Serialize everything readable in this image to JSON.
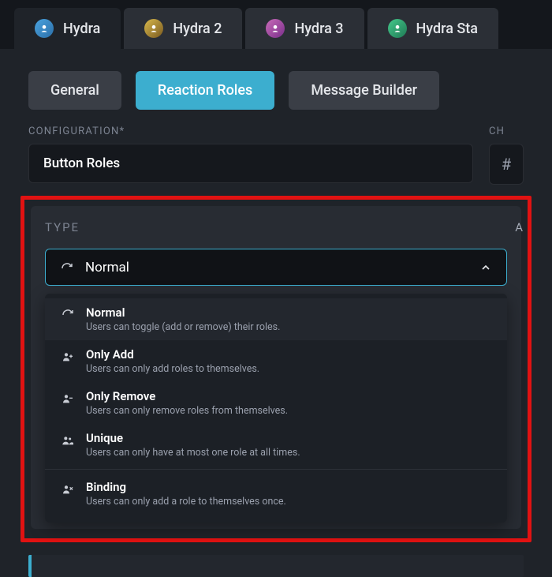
{
  "tabs": [
    {
      "label": "Hydra",
      "iconColor": "blue",
      "active": true
    },
    {
      "label": "Hydra 2",
      "iconColor": "yellow",
      "active": false
    },
    {
      "label": "Hydra 3",
      "iconColor": "pink",
      "active": false
    },
    {
      "label": "Hydra Sta",
      "iconColor": "green",
      "active": false
    }
  ],
  "subTabs": [
    {
      "label": "General",
      "active": false
    },
    {
      "label": "Reaction Roles",
      "active": true
    },
    {
      "label": "Message Builder",
      "active": false
    }
  ],
  "config": {
    "label": "CONFIGURATION*",
    "value": "Button Roles",
    "ch_label": "CH",
    "hash": "#"
  },
  "typeSection": {
    "label": "TYPE",
    "rightStub": "A",
    "selected": "Normal",
    "options": [
      {
        "key": "normal",
        "title": "Normal",
        "desc": "Users can toggle (add or remove) their roles."
      },
      {
        "key": "onlyadd",
        "title": "Only Add",
        "desc": "Users can only add roles to themselves."
      },
      {
        "key": "onlyremove",
        "title": "Only Remove",
        "desc": "Users can only remove roles from themselves."
      },
      {
        "key": "unique",
        "title": "Unique",
        "desc": "Users can only have at most one role at all times."
      },
      {
        "key": "binding",
        "title": "Binding",
        "desc": "Users can only add a role to themselves once."
      }
    ]
  }
}
